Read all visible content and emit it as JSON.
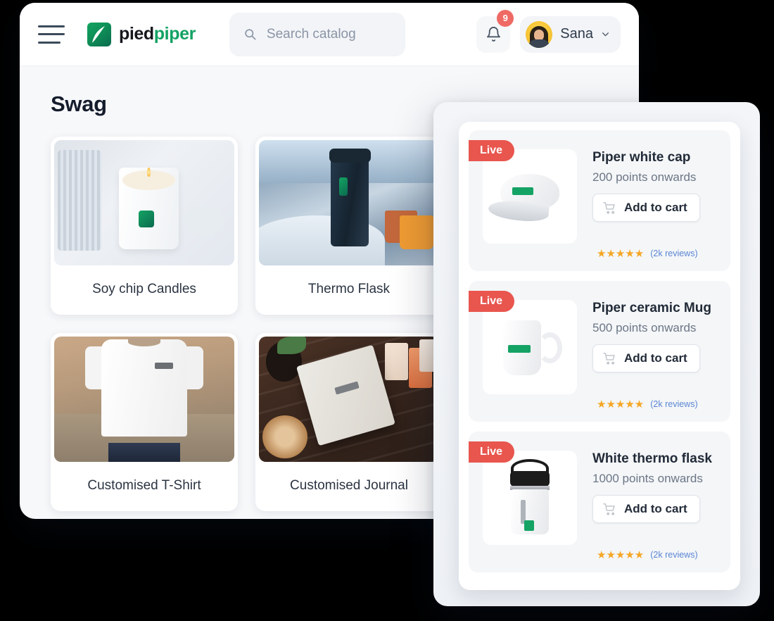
{
  "brand": {
    "name_dark": "pied",
    "name_green": "piper",
    "mark": "leaf-logo"
  },
  "topbar": {
    "menu_icon": "hamburger-menu-icon",
    "search": {
      "placeholder": "Search catalog",
      "value": "",
      "icon": "search-icon"
    },
    "notifications": {
      "icon": "bell-icon",
      "count": "9"
    },
    "user": {
      "name": "Sana",
      "avatar": "user-avatar",
      "caret": "chevron-down-icon"
    }
  },
  "page": {
    "title": "Swag"
  },
  "catalog": {
    "items": [
      {
        "name": "Soy chip Candles",
        "art": "candle"
      },
      {
        "name": "Thermo Flask",
        "art": "flask"
      },
      {
        "name": "Customised T-Shirt",
        "art": "tshirt"
      },
      {
        "name": "Customised Journal",
        "art": "journal"
      }
    ]
  },
  "featured": {
    "badge_label": "Live",
    "cart_label": "Add to cart",
    "cart_icon": "shopping-cart-icon",
    "stars": "★★★★★",
    "items": [
      {
        "title": "Piper white cap",
        "points": "200 points onwards",
        "reviews": "(2k reviews)",
        "art": "cap"
      },
      {
        "title": "Piper ceramic Mug",
        "points": "500 points onwards",
        "reviews": "(2k reviews)",
        "art": "mug"
      },
      {
        "title": "White thermo flask",
        "points": "1000 points onwards",
        "reviews": "(2k reviews)",
        "art": "flask"
      }
    ]
  },
  "colors": {
    "brand_green": "#12a263",
    "live_red": "#e8564e",
    "badge_red": "#ef6a64",
    "star_gold": "#f5a623",
    "review_blue": "#5b86d4",
    "page_bg": "#f7f8fa"
  }
}
